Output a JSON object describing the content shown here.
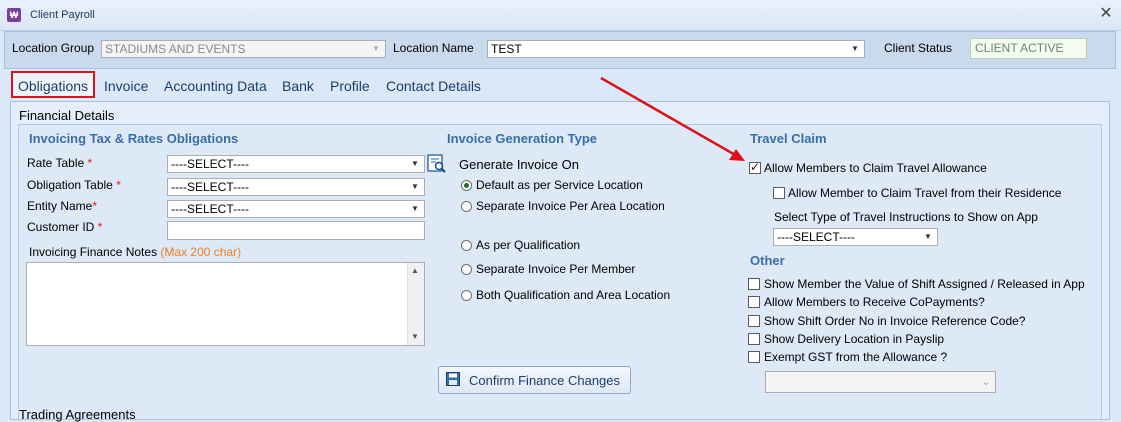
{
  "window": {
    "title": "Client Payroll",
    "icon_label": "₩"
  },
  "header": {
    "location_group_label": "Location Group",
    "location_group_value": "STADIUMS AND EVENTS",
    "location_name_label": "Location Name",
    "location_name_value": "TEST",
    "client_status_label": "Client Status",
    "client_status_value": "CLIENT ACTIVE"
  },
  "tabs": [
    {
      "label": "Obligations",
      "active": true
    },
    {
      "label": "Invoice"
    },
    {
      "label": "Accounting Data"
    },
    {
      "label": "Bank"
    },
    {
      "label": "Profile"
    },
    {
      "label": "Contact Details"
    }
  ],
  "panel": {
    "title": "Financial Details",
    "bottom_section_title": "Trading Agreements"
  },
  "invoicing": {
    "title": "Invoicing Tax & Rates Obligations",
    "fields": [
      {
        "label": "Rate Table",
        "required_mark": "*",
        "value": "----SELECT----"
      },
      {
        "label": "Obligation Table",
        "required_mark": "*",
        "value": "----SELECT----"
      },
      {
        "label": "Entity Name",
        "required_mark": "*",
        "value": "----SELECT----"
      },
      {
        "label": "Customer ID",
        "required_mark": "*",
        "value": ""
      }
    ],
    "notes_label": "Invoicing Finance Notes",
    "notes_hint": "(Max 200 char)",
    "notes_value": ""
  },
  "invoice_generation": {
    "title": "Invoice Generation Type",
    "subtitle": "Generate Invoice On",
    "options": [
      {
        "label": "Default as per Service Location",
        "selected": true
      },
      {
        "label": "Separate Invoice Per Area Location",
        "selected": false
      },
      {
        "label": "As per Qualification",
        "selected": false
      },
      {
        "label": "Separate Invoice Per Member",
        "selected": false
      },
      {
        "label": "Both Qualification and Area Location",
        "selected": false
      }
    ],
    "confirm_button": "Confirm Finance Changes"
  },
  "travel_claim": {
    "title": "Travel Claim",
    "allow_travel": {
      "label": "Allow Members to Claim Travel Allowance",
      "checked": true
    },
    "allow_residence": {
      "label": "Allow Member to Claim Travel from their Residence",
      "checked": false
    },
    "instructions_label": "Select Type of Travel Instructions to Show on App",
    "instructions_value": "----SELECT----"
  },
  "other": {
    "title": "Other",
    "options": [
      {
        "label": "Show Member the Value of Shift Assigned / Released in App",
        "checked": false
      },
      {
        "label": "Allow Members to Receive CoPayments?",
        "checked": false
      },
      {
        "label": "Show Shift Order No in Invoice Reference Code?",
        "checked": false
      },
      {
        "label": "Show Delivery Location in Payslip",
        "checked": false
      },
      {
        "label": "Exempt GST from the Allowance ?",
        "checked": false
      }
    ],
    "gst_select_value": ""
  },
  "colors": {
    "accent": "#3a6ea8",
    "highlight": "#e0101a",
    "required": "#e01a1a",
    "hint": "#f08020"
  }
}
